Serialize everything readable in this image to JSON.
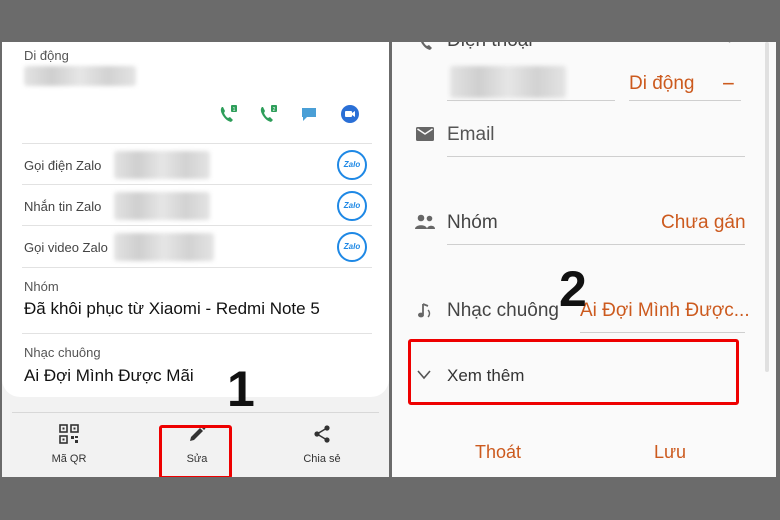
{
  "left": {
    "mobile_label": "Di động",
    "zalo_rows": [
      {
        "label": "Gọi điện Zalo"
      },
      {
        "label": "Nhắn tin Zalo"
      },
      {
        "label": "Gọi video Zalo"
      }
    ],
    "zalo_badge": "Zalo",
    "group": {
      "label": "Nhóm",
      "value": "Đã khôi phục từ Xiaomi - Redmi Note 5"
    },
    "ringtone": {
      "label": "Nhạc chuông",
      "value": "Ai Đợi Mình Được Mãi"
    },
    "bottom_bar": {
      "qr_label": "Mã QR",
      "edit_label": "Sửa",
      "share_label": "Chia sẻ"
    },
    "step_number": "1"
  },
  "right": {
    "phone_label": "Điện thoại",
    "phone_type": "Di động",
    "remove_symbol": "−",
    "add_symbol": "+",
    "email_placeholder": "Email",
    "group": {
      "label": "Nhóm",
      "value": "Chưa gán"
    },
    "ringtone": {
      "label": "Nhạc chuông",
      "value": "Ai Đợi Mình Được..."
    },
    "more_label": "Xem thêm",
    "cancel_label": "Thoát",
    "save_label": "Lưu",
    "step_number": "2"
  },
  "colors": {
    "accent_orange": "#cc5a1e",
    "call_green": "#2e9e5a",
    "zalo_blue": "#1e88e5",
    "highlight_red": "#e00000"
  }
}
